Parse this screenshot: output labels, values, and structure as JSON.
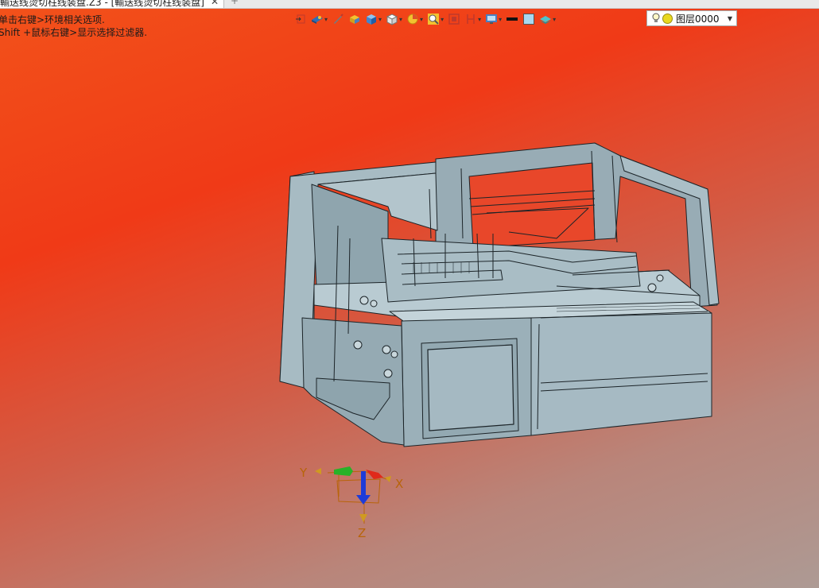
{
  "tab": {
    "title": "輸送线烫切柱线装盘.Z3 - [輸送线烫切柱线装盘]",
    "close": "✕",
    "new_tab": "+"
  },
  "hints": [
    "单击右键>环境相关选项.",
    "Shift +鼠标右键>显示选择过滤器."
  ],
  "toolbar": {
    "icons": [
      "select-filter-icon",
      "render-mode-icon",
      "pencil-icon",
      "box-icon",
      "solid-cube-icon",
      "view-cube-icon",
      "pie-icon",
      "zoom-icon",
      "fit-view-icon",
      "section-icon",
      "display-icon",
      "line-color-icon",
      "fill-color-icon",
      "layer-stack-icon"
    ],
    "layer": {
      "value": "图层0000"
    }
  },
  "axes": {
    "x": "X",
    "y": "Y",
    "z": "Z"
  },
  "colors": {
    "model_fill": "#9fb4bd",
    "model_dark": "#7f959e",
    "model_line": "#1c2428",
    "accent_red": "#e02a1a"
  }
}
